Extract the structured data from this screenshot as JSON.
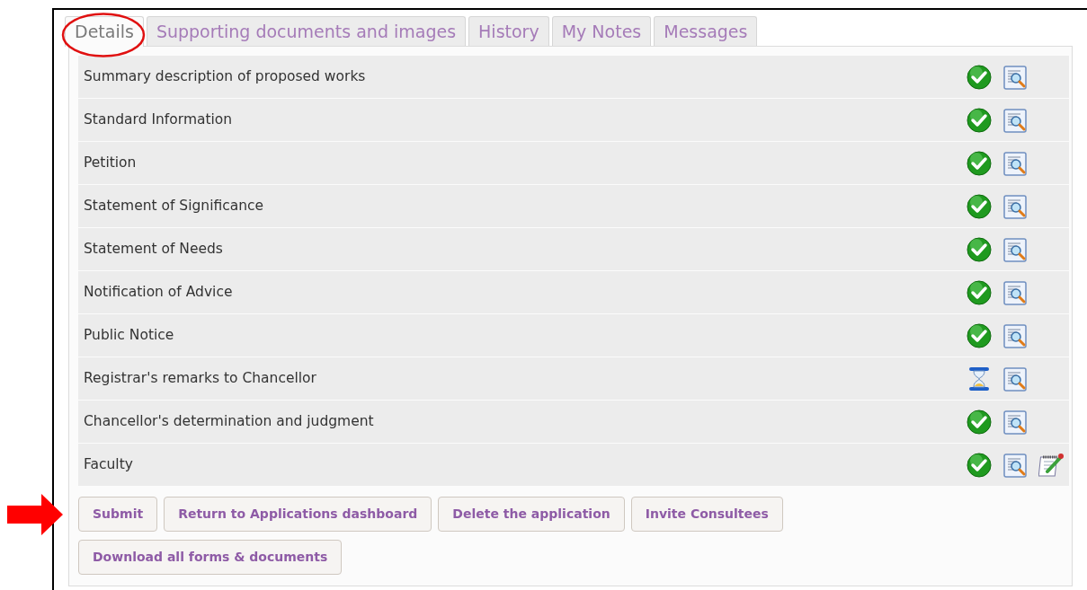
{
  "tabs": [
    {
      "label": "Details",
      "selected": true,
      "circled": true
    },
    {
      "label": "Supporting documents and images",
      "selected": false,
      "circled": false
    },
    {
      "label": "History",
      "selected": false,
      "circled": false
    },
    {
      "label": "My Notes",
      "selected": false,
      "circled": false
    },
    {
      "label": "Messages",
      "selected": false,
      "circled": false
    }
  ],
  "sections": [
    {
      "label": "Summary description of proposed works",
      "done": true,
      "editable": false
    },
    {
      "label": "Standard Information",
      "done": true,
      "editable": false
    },
    {
      "label": "Petition",
      "done": true,
      "editable": false
    },
    {
      "label": "Statement of Significance",
      "done": true,
      "editable": false
    },
    {
      "label": "Statement of Needs",
      "done": true,
      "editable": false
    },
    {
      "label": "Notification of Advice",
      "done": true,
      "editable": false
    },
    {
      "label": "Public Notice",
      "done": true,
      "editable": false
    },
    {
      "label": "Registrar's remarks to Chancellor",
      "done": false,
      "editable": false
    },
    {
      "label": "Chancellor's determination and judgment",
      "done": true,
      "editable": false
    },
    {
      "label": "Faculty",
      "done": true,
      "editable": true
    }
  ],
  "buttons": [
    {
      "label": "Submit",
      "pointed_at": true
    },
    {
      "label": "Return to Applications dashboard",
      "pointed_at": false
    },
    {
      "label": "Delete the application",
      "pointed_at": false
    },
    {
      "label": "Invite Consultees",
      "pointed_at": false
    },
    {
      "label": "Download all forms & documents",
      "pointed_at": false
    }
  ]
}
